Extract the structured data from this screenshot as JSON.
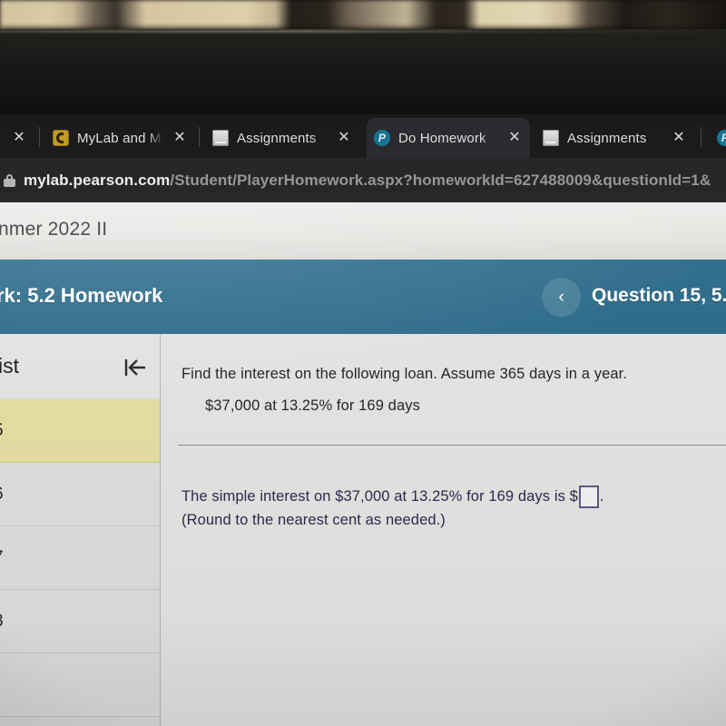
{
  "browser": {
    "tabs": [
      {
        "title": "",
        "favicon": "none",
        "close_label": "✕",
        "active": false,
        "partial": true
      },
      {
        "title": "MyLab and Ma",
        "favicon": "mylab-icon",
        "close_label": "✕",
        "active": false
      },
      {
        "title": "Assignments",
        "favicon": "document-icon",
        "close_label": "✕",
        "active": false
      },
      {
        "title": "Do Homework",
        "favicon": "pearson-icon",
        "close_label": "✕",
        "active": true
      },
      {
        "title": "Assignments",
        "favicon": "document-icon",
        "close_label": "✕",
        "active": false
      },
      {
        "title": "",
        "favicon": "pearson-icon",
        "close_label": "",
        "active": false,
        "partial": true
      }
    ],
    "address_bar": {
      "lock_icon": "lock-icon",
      "host": "mylab.pearson.com",
      "path": "/Student/PlayerHomework.aspx?homeworkId=627488009&questionId=1&"
    }
  },
  "page": {
    "course_name": "nmer 2022 II",
    "homework_title": "rk: 5.2 Homework",
    "prev_icon": "‹",
    "question_label": "Question 15, 5.",
    "sidebar": {
      "title": "ist",
      "collapse_icon": "collapse-left-icon",
      "questions": [
        {
          "number": "5",
          "current": true
        },
        {
          "number": "6",
          "current": false
        },
        {
          "number": "7",
          "current": false
        },
        {
          "number": "8",
          "current": false
        }
      ]
    },
    "question": {
      "prompt": "Find the interest on the following loan. Assume 365 days in a year.",
      "detail": "$37,000 at 13.25% for 169 days",
      "answer_prefix": "The simple interest on $37,000 at 13.25% for 169 days is $",
      "answer_value": "",
      "answer_suffix": ".",
      "rounding_hint": "(Round to the nearest cent as needed.)"
    }
  },
  "colors": {
    "header_blue": "#2c6b8a",
    "highlight_yellow": "#e3dda2",
    "answer_text": "#2b2a4d",
    "input_border": "#5b5a86",
    "browser_dark": "#1f1f21"
  }
}
